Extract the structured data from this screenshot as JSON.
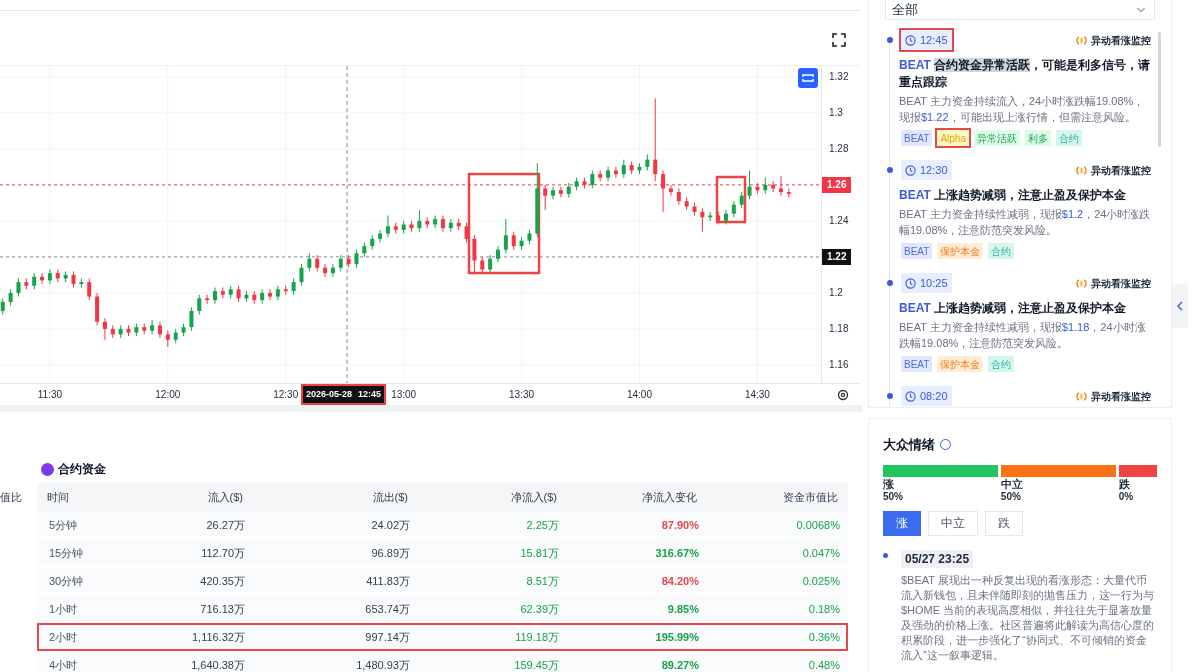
{
  "chart": {
    "crosshair_date": "2026-05-28",
    "crosshair_time": "12:45",
    "chart_data": {
      "type": "candlestick",
      "grid": true,
      "xlim": [
        677.3,
        896.1
      ],
      "ylim": [
        1.15,
        1.326
      ],
      "ref_lines": [
        {
          "axis": "x",
          "value": 765.6,
          "color": "#888888"
        },
        {
          "axis": "y",
          "value": 1.22,
          "color": "#888888",
          "label": "1.22"
        },
        {
          "axis": "y",
          "value": 1.26,
          "color": "#f23645",
          "label": "1.26"
        }
      ],
      "yticks": [
        {
          "value": 1.32,
          "label": "1.32"
        },
        {
          "value": 1.3,
          "label": "1.3"
        },
        {
          "value": 1.28,
          "label": "1.28"
        },
        {
          "value": 1.24,
          "label": "1.24"
        },
        {
          "value": 1.2,
          "label": "1.2"
        },
        {
          "value": 1.18,
          "label": "1.18"
        },
        {
          "value": 1.16,
          "label": "1.16"
        }
      ],
      "xticks": [
        {
          "value": 690,
          "label": "11:30"
        },
        {
          "value": 720,
          "label": "12:00"
        },
        {
          "value": 750,
          "label": "12:30"
        },
        {
          "value": 780,
          "label": "13:00"
        },
        {
          "value": 810,
          "label": "13:30"
        },
        {
          "value": 840,
          "label": "14:00"
        },
        {
          "value": 870,
          "label": "14:30"
        }
      ],
      "x": [
        678,
        680,
        682,
        684,
        686,
        688,
        690,
        692,
        694,
        696,
        698,
        700,
        702,
        704,
        706,
        708,
        710,
        712,
        714,
        716,
        718,
        720,
        722,
        724,
        726,
        728,
        730,
        732,
        734,
        736,
        738,
        740,
        742,
        744,
        746,
        748,
        750,
        752,
        754,
        756,
        758,
        760,
        762,
        764,
        766,
        768,
        770,
        772,
        774,
        776,
        778,
        780,
        782,
        784,
        786,
        788,
        790,
        792,
        794,
        796,
        798,
        800,
        802,
        804,
        806,
        808,
        810,
        812,
        814,
        816,
        818,
        820,
        822,
        824,
        826,
        828,
        830,
        832,
        834,
        836,
        838,
        840,
        842,
        844,
        846,
        848,
        850,
        852,
        854,
        856,
        858,
        860,
        862,
        864,
        866,
        868,
        870,
        872,
        874,
        876,
        878
      ],
      "ohlc": [
        [
          1.19,
          1.197,
          1.188,
          1.195
        ],
        [
          1.195,
          1.202,
          1.193,
          1.2
        ],
        [
          1.2,
          1.208,
          1.198,
          1.206
        ],
        [
          1.206,
          1.208,
          1.202,
          1.204
        ],
        [
          1.204,
          1.211,
          1.202,
          1.209
        ],
        [
          1.209,
          1.211,
          1.205,
          1.207
        ],
        [
          1.207,
          1.213,
          1.205,
          1.211
        ],
        [
          1.211,
          1.213,
          1.206,
          1.208
        ],
        [
          1.208,
          1.212,
          1.206,
          1.21
        ],
        [
          1.21,
          1.212,
          1.203,
          1.205
        ],
        [
          1.205,
          1.208,
          1.203,
          1.206
        ],
        [
          1.206,
          1.208,
          1.196,
          1.198
        ],
        [
          1.198,
          1.2,
          1.182,
          1.184
        ],
        [
          1.184,
          1.186,
          1.174,
          1.18
        ],
        [
          1.18,
          1.182,
          1.175,
          1.177
        ],
        [
          1.177,
          1.182,
          1.175,
          1.18
        ],
        [
          1.18,
          1.182,
          1.176,
          1.178
        ],
        [
          1.178,
          1.183,
          1.176,
          1.181
        ],
        [
          1.181,
          1.183,
          1.177,
          1.179
        ],
        [
          1.179,
          1.185,
          1.177,
          1.182
        ],
        [
          1.182,
          1.184,
          1.175,
          1.177
        ],
        [
          1.177,
          1.179,
          1.17,
          1.174
        ],
        [
          1.174,
          1.18,
          1.172,
          1.178
        ],
        [
          1.178,
          1.183,
          1.176,
          1.181
        ],
        [
          1.181,
          1.192,
          1.179,
          1.19
        ],
        [
          1.19,
          1.199,
          1.188,
          1.197
        ],
        [
          1.197,
          1.199,
          1.194,
          1.196
        ],
        [
          1.196,
          1.203,
          1.194,
          1.201
        ],
        [
          1.201,
          1.203,
          1.197,
          1.199
        ],
        [
          1.199,
          1.204,
          1.197,
          1.202
        ],
        [
          1.202,
          1.204,
          1.195,
          1.197
        ],
        [
          1.197,
          1.201,
          1.195,
          1.199
        ],
        [
          1.199,
          1.201,
          1.194,
          1.196
        ],
        [
          1.196,
          1.202,
          1.194,
          1.2
        ],
        [
          1.2,
          1.202,
          1.196,
          1.198
        ],
        [
          1.198,
          1.204,
          1.196,
          1.202
        ],
        [
          1.202,
          1.204,
          1.199,
          1.201
        ],
        [
          1.201,
          1.208,
          1.199,
          1.206
        ],
        [
          1.206,
          1.216,
          1.204,
          1.214
        ],
        [
          1.214,
          1.222,
          1.212,
          1.219
        ],
        [
          1.219,
          1.221,
          1.212,
          1.214
        ],
        [
          1.214,
          1.216,
          1.209,
          1.211
        ],
        [
          1.211,
          1.216,
          1.209,
          1.214
        ],
        [
          1.214,
          1.221,
          1.212,
          1.219
        ],
        [
          1.219,
          1.221,
          1.214,
          1.216
        ],
        [
          1.216,
          1.224,
          1.214,
          1.222
        ],
        [
          1.222,
          1.228,
          1.22,
          1.226
        ],
        [
          1.226,
          1.232,
          1.224,
          1.23
        ],
        [
          1.23,
          1.235,
          1.228,
          1.233
        ],
        [
          1.233,
          1.243,
          1.231,
          1.237
        ],
        [
          1.237,
          1.239,
          1.233,
          1.235
        ],
        [
          1.235,
          1.24,
          1.233,
          1.238
        ],
        [
          1.238,
          1.24,
          1.234,
          1.236
        ],
        [
          1.236,
          1.246,
          1.234,
          1.24
        ],
        [
          1.24,
          1.242,
          1.236,
          1.238
        ],
        [
          1.238,
          1.243,
          1.236,
          1.241
        ],
        [
          1.241,
          1.243,
          1.234,
          1.236
        ],
        [
          1.236,
          1.241,
          1.234,
          1.239
        ],
        [
          1.239,
          1.241,
          1.235,
          1.237
        ],
        [
          1.237,
          1.239,
          1.228,
          1.23
        ],
        [
          1.23,
          1.232,
          1.211,
          1.218
        ],
        [
          1.218,
          1.22,
          1.211,
          1.213
        ],
        [
          1.213,
          1.221,
          1.211,
          1.219
        ],
        [
          1.219,
          1.226,
          1.217,
          1.224
        ],
        [
          1.224,
          1.241,
          1.222,
          1.232
        ],
        [
          1.232,
          1.234,
          1.224,
          1.226
        ],
        [
          1.226,
          1.231,
          1.224,
          1.229
        ],
        [
          1.229,
          1.235,
          1.227,
          1.233
        ],
        [
          1.233,
          1.272,
          1.231,
          1.258
        ],
        [
          1.258,
          1.26,
          1.246,
          1.254
        ],
        [
          1.254,
          1.259,
          1.252,
          1.257
        ],
        [
          1.257,
          1.259,
          1.253,
          1.255
        ],
        [
          1.255,
          1.261,
          1.253,
          1.259
        ],
        [
          1.259,
          1.264,
          1.257,
          1.262
        ],
        [
          1.262,
          1.264,
          1.258,
          1.26
        ],
        [
          1.26,
          1.268,
          1.258,
          1.266
        ],
        [
          1.266,
          1.268,
          1.262,
          1.264
        ],
        [
          1.264,
          1.27,
          1.262,
          1.268
        ],
        [
          1.268,
          1.27,
          1.264,
          1.266
        ],
        [
          1.266,
          1.274,
          1.264,
          1.271
        ],
        [
          1.271,
          1.273,
          1.266,
          1.268
        ],
        [
          1.268,
          1.272,
          1.266,
          1.27
        ],
        [
          1.27,
          1.277,
          1.268,
          1.274
        ],
        [
          1.274,
          1.308,
          1.262,
          1.266
        ],
        [
          1.266,
          1.268,
          1.245,
          1.258
        ],
        [
          1.258,
          1.26,
          1.254,
          1.256
        ],
        [
          1.256,
          1.258,
          1.249,
          1.251
        ],
        [
          1.251,
          1.253,
          1.246,
          1.248
        ],
        [
          1.248,
          1.25,
          1.243,
          1.245
        ],
        [
          1.245,
          1.247,
          1.234,
          1.242
        ],
        [
          1.242,
          1.245,
          1.24,
          1.243
        ],
        [
          1.243,
          1.245,
          1.238,
          1.24
        ],
        [
          1.24,
          1.246,
          1.238,
          1.244
        ],
        [
          1.244,
          1.251,
          1.242,
          1.249
        ],
        [
          1.249,
          1.256,
          1.247,
          1.254
        ],
        [
          1.254,
          1.268,
          1.252,
          1.259
        ],
        [
          1.259,
          1.261,
          1.255,
          1.257
        ],
        [
          1.257,
          1.264,
          1.255,
          1.26
        ],
        [
          1.26,
          1.262,
          1.256,
          1.258
        ],
        [
          1.258,
          1.265,
          1.254,
          1.256
        ],
        [
          1.256,
          1.258,
          1.253,
          1.255
        ]
      ]
    }
  },
  "funding": {
    "title": "合约资金",
    "stub_header": "值比",
    "columns": [
      "时间",
      "流入($)",
      "流出($)",
      "净流入($)",
      "净流入变化",
      "资金市值比"
    ],
    "rows": [
      {
        "period": "5分钟",
        "inflow": "26.27万",
        "outflow": "24.02万",
        "net": "2.25万",
        "change": {
          "value": "87.90%",
          "color": "#e5484d"
        },
        "ratio": "0.0068%",
        "highlighted": false
      },
      {
        "period": "15分钟",
        "inflow": "112.70万",
        "outflow": "96.89万",
        "net": "15.81万",
        "change": {
          "value": "316.67%",
          "color": "#16a34a"
        },
        "ratio": "0.047%",
        "highlighted": false
      },
      {
        "period": "30分钟",
        "inflow": "420.35万",
        "outflow": "411.83万",
        "net": "8.51万",
        "change": {
          "value": "84.20%",
          "color": "#e5484d"
        },
        "ratio": "0.025%",
        "highlighted": false
      },
      {
        "period": "1小时",
        "inflow": "716.13万",
        "outflow": "653.74万",
        "net": "62.39万",
        "change": {
          "value": "9.85%",
          "color": "#16a34a"
        },
        "ratio": "0.18%",
        "highlighted": false
      },
      {
        "period": "2小时",
        "inflow": "1,116.32万",
        "outflow": "997.14万",
        "net": "119.18万",
        "change": {
          "value": "195.99%",
          "color": "#16a34a"
        },
        "ratio": "0.36%",
        "highlighted": true
      },
      {
        "period": "4小时",
        "inflow": "1,640.38万",
        "outflow": "1,480.93万",
        "net": "159.45万",
        "change": {
          "value": "89.27%",
          "color": "#16a34a"
        },
        "ratio": "0.48%",
        "highlighted": false
      }
    ]
  },
  "alerts": {
    "filter": "全部",
    "items": [
      {
        "time": "12:45",
        "highlighted": true,
        "source": "异动看涨监控",
        "symbol": "BEAT",
        "title_selected": "合约资金异常活跃",
        "title_rest": "，可能是利多信号，请重点跟踪",
        "body_before": "BEAT 主力资金持续流入，24小时涨跌幅19.08%，现报",
        "price": "$1.22",
        "body_after": "，可能出现上涨行情，但需注意风险。",
        "tags": [
          {
            "label": "BEAT",
            "kind": "symbol",
            "highlighted": false
          },
          {
            "label": "Alpha",
            "kind": "alpha",
            "highlighted": true
          },
          {
            "label": "异常活跃",
            "kind": "event",
            "highlighted": false
          },
          {
            "label": "利多",
            "kind": "event",
            "highlighted": false
          },
          {
            "label": "合约",
            "kind": "contract",
            "highlighted": false
          }
        ]
      },
      {
        "time": "12:30",
        "highlighted": false,
        "source": "异动看涨监控",
        "symbol": "BEAT",
        "title_rest": "上涨趋势减弱，注意止盈及保护本金",
        "body_before": "BEAT 主力资金持续性减弱，现报",
        "price": "$1.2",
        "body_after": "，24小时涨跌幅19.08%，注意防范突发风险。",
        "tags": [
          {
            "label": "BEAT",
            "kind": "symbol",
            "highlighted": false
          },
          {
            "label": "保护本金",
            "kind": "risk",
            "highlighted": false
          },
          {
            "label": "合约",
            "kind": "contract",
            "highlighted": false
          }
        ]
      },
      {
        "time": "10:25",
        "highlighted": false,
        "source": "异动看涨监控",
        "symbol": "BEAT",
        "title_rest": "上涨趋势减弱，注意止盈及保护本金",
        "body_before": "BEAT 主力资金持续性减弱，现报",
        "price": "$1.18",
        "body_after": "，24小时涨跌幅19.08%，注意防范突发风险。",
        "tags": [
          {
            "label": "BEAT",
            "kind": "symbol",
            "highlighted": false
          },
          {
            "label": "保护本金",
            "kind": "risk",
            "highlighted": false
          },
          {
            "label": "合约",
            "kind": "contract",
            "highlighted": false
          }
        ]
      },
      {
        "time": "08:20",
        "highlighted": false,
        "source": "异动看涨监控"
      }
    ]
  },
  "sentiment": {
    "title": "大众情绪",
    "bars": [
      {
        "label": "涨",
        "percent": "50%",
        "kind": "up"
      },
      {
        "label": "中立",
        "percent": "50%",
        "kind": "neutral"
      },
      {
        "label": "跌",
        "percent": "0%",
        "kind": "down"
      }
    ],
    "tabs": [
      {
        "label": "涨",
        "selected": true
      },
      {
        "label": "中立",
        "selected": false
      },
      {
        "label": "跌",
        "selected": false
      }
    ],
    "posts": [
      {
        "time": "05/27 23:25",
        "text": "$BEAT 展现出一种反复出现的看涨形态：大量代币流入新钱包，且未伴随即刻的抛售压力，这一行为与 $HOME 当前的表现高度相似，并往往先于显著放量及强劲的价格上涨。社区普遍将此解读为高信心度的积累阶段，进一步强化了“协同式、不可倾销的资金流入”这一叙事逻辑。"
      }
    ]
  }
}
